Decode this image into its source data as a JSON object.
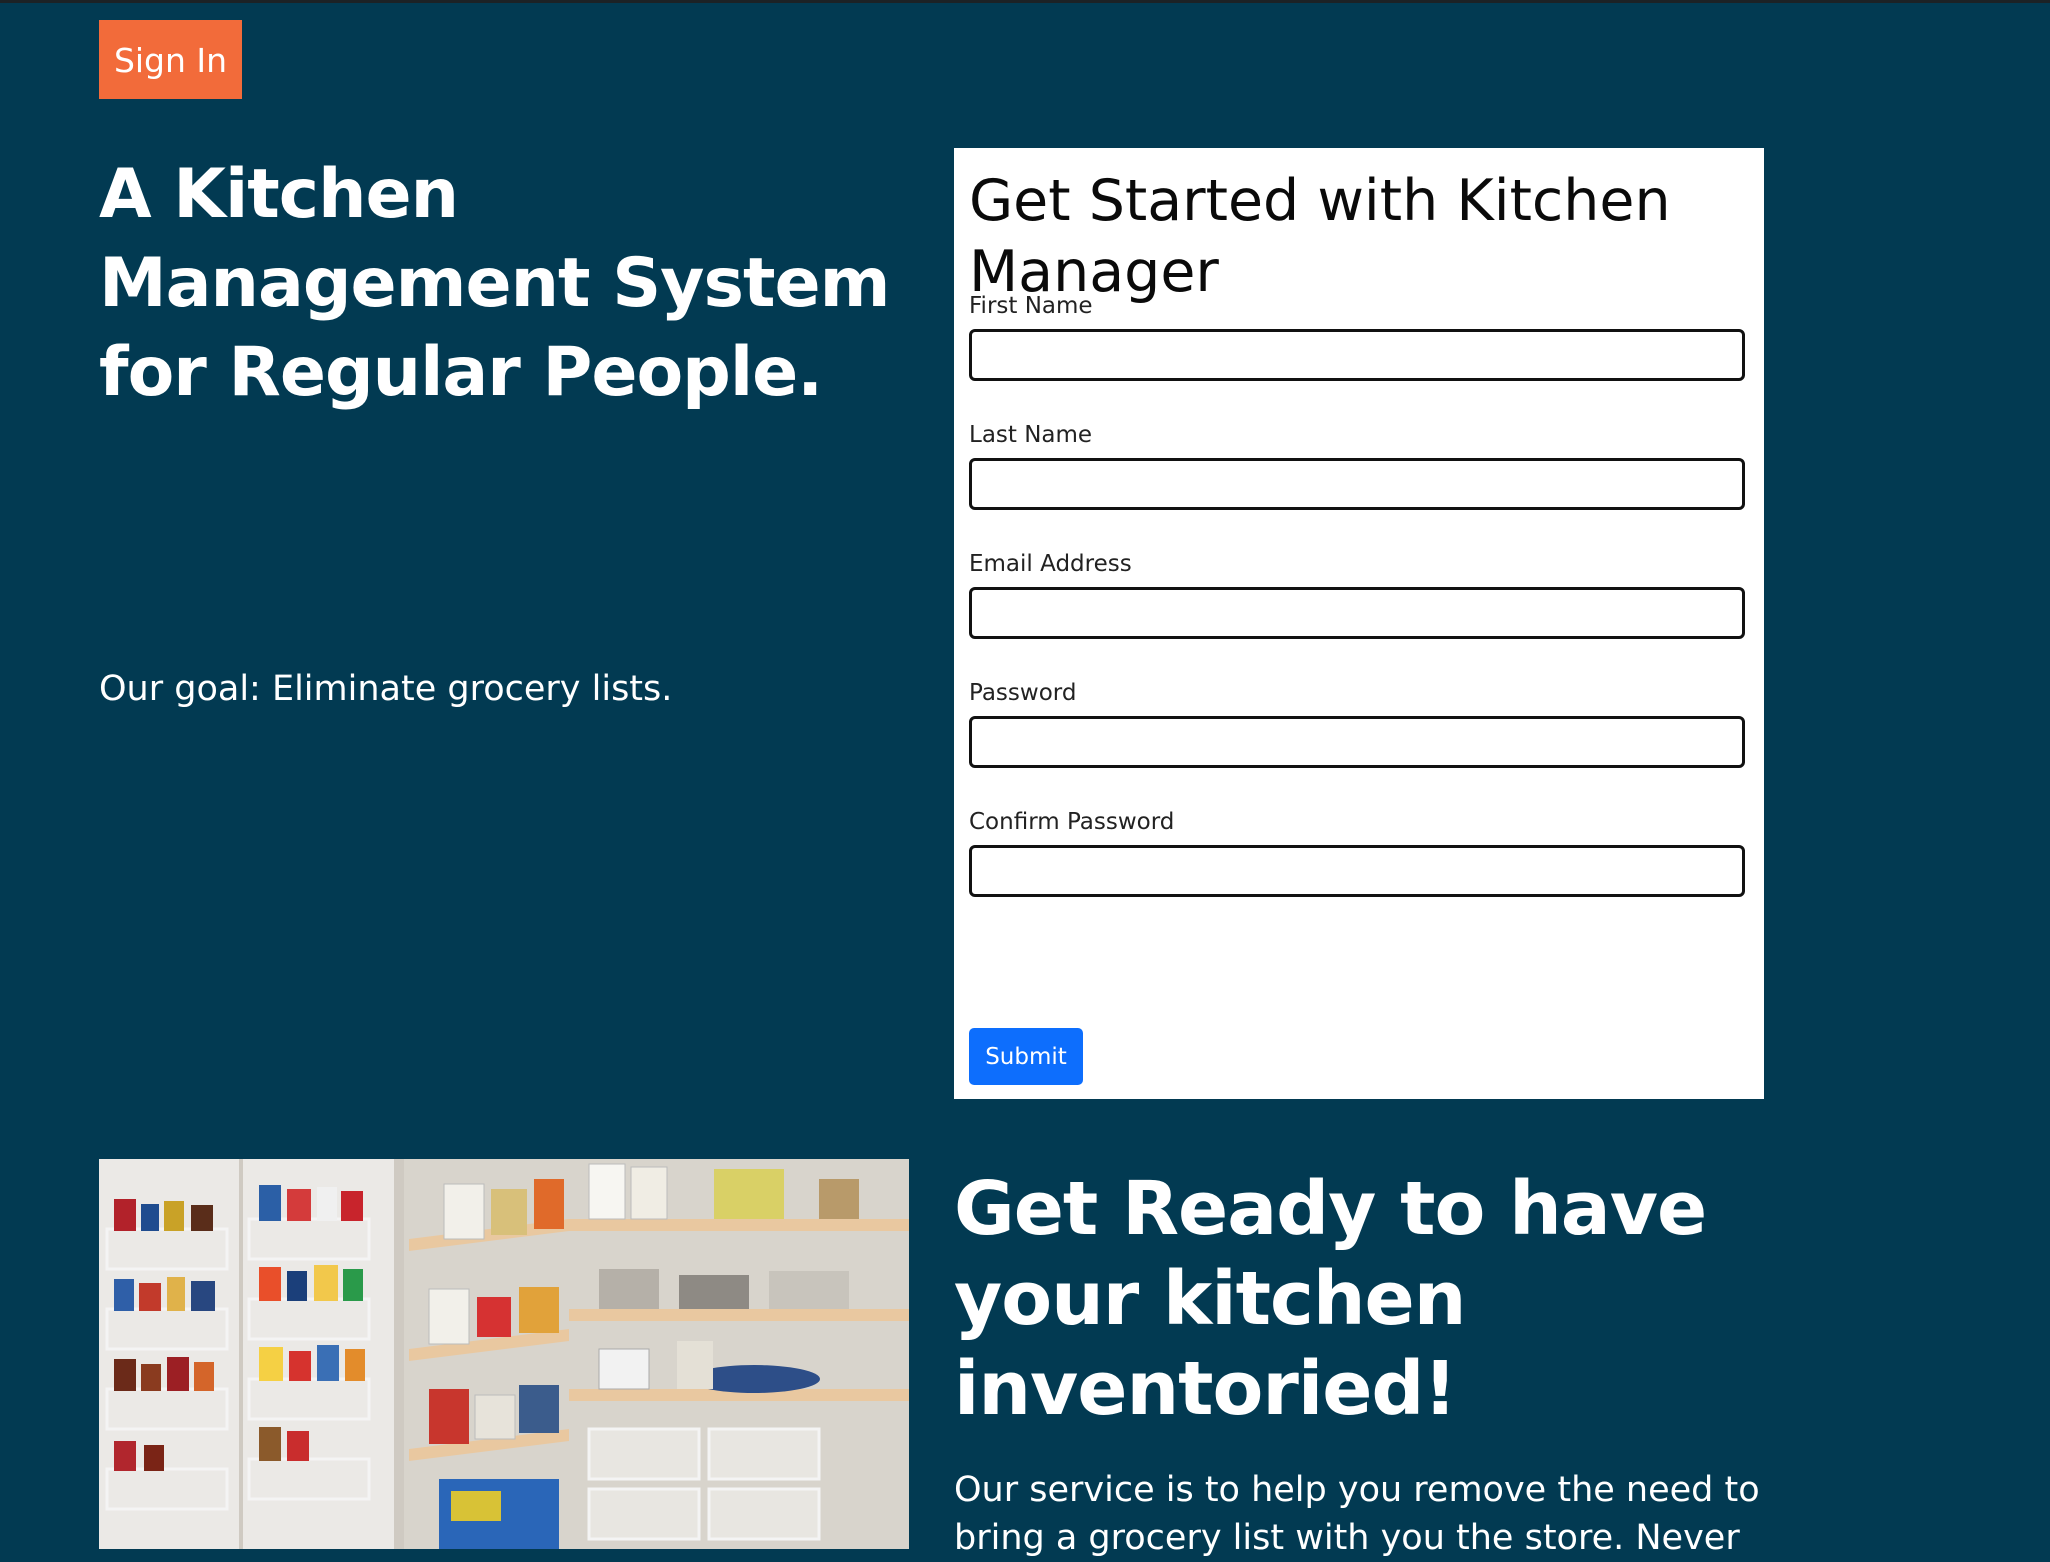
{
  "header": {
    "sign_in_label": "Sign In"
  },
  "hero": {
    "title": "A Kitchen Management System for Regular People.",
    "goal": "Our goal: Eliminate grocery lists."
  },
  "signup_form": {
    "title": "Get Started with Kitchen Manager",
    "fields": [
      {
        "label": "First Name",
        "value": ""
      },
      {
        "label": "Last Name",
        "value": ""
      },
      {
        "label": "Email Address",
        "value": ""
      },
      {
        "label": "Password",
        "value": ""
      },
      {
        "label": "Confirm Password",
        "value": ""
      }
    ],
    "submit_label": "Submit"
  },
  "section": {
    "title": "Get Ready to have your kitchen inventoried!",
    "body": "Our service is to help you remove the need to bring a grocery list with you the store. Never"
  },
  "colors": {
    "background": "#023a52",
    "accent_orange": "#f26b3a",
    "submit_blue": "#0d6efd"
  }
}
